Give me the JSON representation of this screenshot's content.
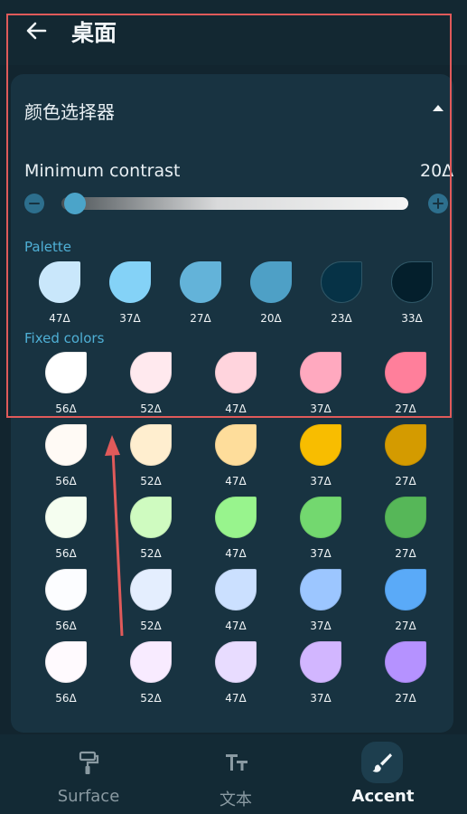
{
  "header": {
    "title": "桌面"
  },
  "picker": {
    "title": "颜色选择器",
    "contrast_label": "Minimum contrast",
    "contrast_value": "20Δ",
    "contrast_fraction": 0.02
  },
  "palette": {
    "label": "Palette",
    "swatches": [
      {
        "color": "#c9e7fb",
        "value": "47Δ"
      },
      {
        "color": "#84d2f7",
        "value": "37Δ"
      },
      {
        "color": "#63b3d9",
        "value": "27Δ"
      },
      {
        "color": "#4ea0c6",
        "value": "20Δ"
      },
      {
        "color": "#063246",
        "value": "23Δ"
      },
      {
        "color": "#041f2c",
        "value": "33Δ"
      }
    ]
  },
  "fixed": {
    "label": "Fixed colors",
    "rows": [
      [
        {
          "color": "#ffffff",
          "value": "56Δ"
        },
        {
          "color": "#ffe9ee",
          "value": "52Δ"
        },
        {
          "color": "#ffd4dd",
          "value": "47Δ"
        },
        {
          "color": "#ffa9bf",
          "value": "37Δ"
        },
        {
          "color": "#ff7f9b",
          "value": "27Δ"
        }
      ],
      [
        {
          "color": "#fffaf5",
          "value": "56Δ"
        },
        {
          "color": "#ffeecf",
          "value": "52Δ"
        },
        {
          "color": "#fedd9b",
          "value": "47Δ"
        },
        {
          "color": "#f8bd00",
          "value": "37Δ"
        },
        {
          "color": "#d49b00",
          "value": "27Δ"
        }
      ],
      [
        {
          "color": "#f5fef0",
          "value": "56Δ"
        },
        {
          "color": "#cffbc0",
          "value": "52Δ"
        },
        {
          "color": "#98f48d",
          "value": "47Δ"
        },
        {
          "color": "#73d86f",
          "value": "37Δ"
        },
        {
          "color": "#56b758",
          "value": "27Δ"
        }
      ],
      [
        {
          "color": "#fcfdff",
          "value": "56Δ"
        },
        {
          "color": "#e4eefe",
          "value": "52Δ"
        },
        {
          "color": "#cbe0ff",
          "value": "47Δ"
        },
        {
          "color": "#9cc6ff",
          "value": "37Δ"
        },
        {
          "color": "#5aaaf8",
          "value": "27Δ"
        }
      ],
      [
        {
          "color": "#fffafe",
          "value": "56Δ"
        },
        {
          "color": "#f8ebff",
          "value": "52Δ"
        },
        {
          "color": "#e8dcff",
          "value": "47Δ"
        },
        {
          "color": "#d2b6ff",
          "value": "37Δ"
        },
        {
          "color": "#b592ff",
          "value": "27Δ"
        }
      ]
    ]
  },
  "nav": {
    "items": [
      {
        "label": "Surface",
        "icon": "paint-roller-icon",
        "active": false
      },
      {
        "label": "文本",
        "icon": "text-format-icon",
        "active": false
      },
      {
        "label": "Accent",
        "icon": "brush-icon",
        "active": true
      }
    ]
  },
  "colors": {
    "accent": "#4fb0d6",
    "annotation": "#e05a5a"
  }
}
